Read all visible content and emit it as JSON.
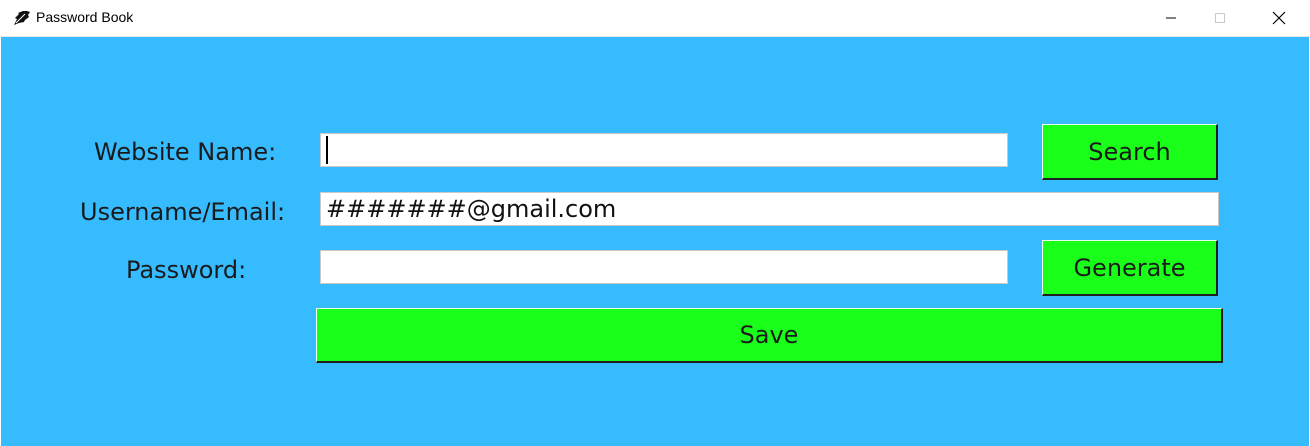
{
  "window": {
    "title": "Password Book",
    "icons": {
      "app": "feather-quill-icon",
      "minimize": "minimize-icon",
      "maximize": "maximize-icon",
      "close": "close-icon"
    }
  },
  "colors": {
    "background": "#36bbff",
    "button": "#1aff1a",
    "field": "#ffffff"
  },
  "form": {
    "website_label": "Website Name:",
    "website_value": "",
    "username_label": "Username/Email:",
    "username_value": "#######@gmail.com",
    "password_label": "Password:",
    "password_value": ""
  },
  "buttons": {
    "search": "Search",
    "generate": "Generate",
    "save": "Save"
  }
}
